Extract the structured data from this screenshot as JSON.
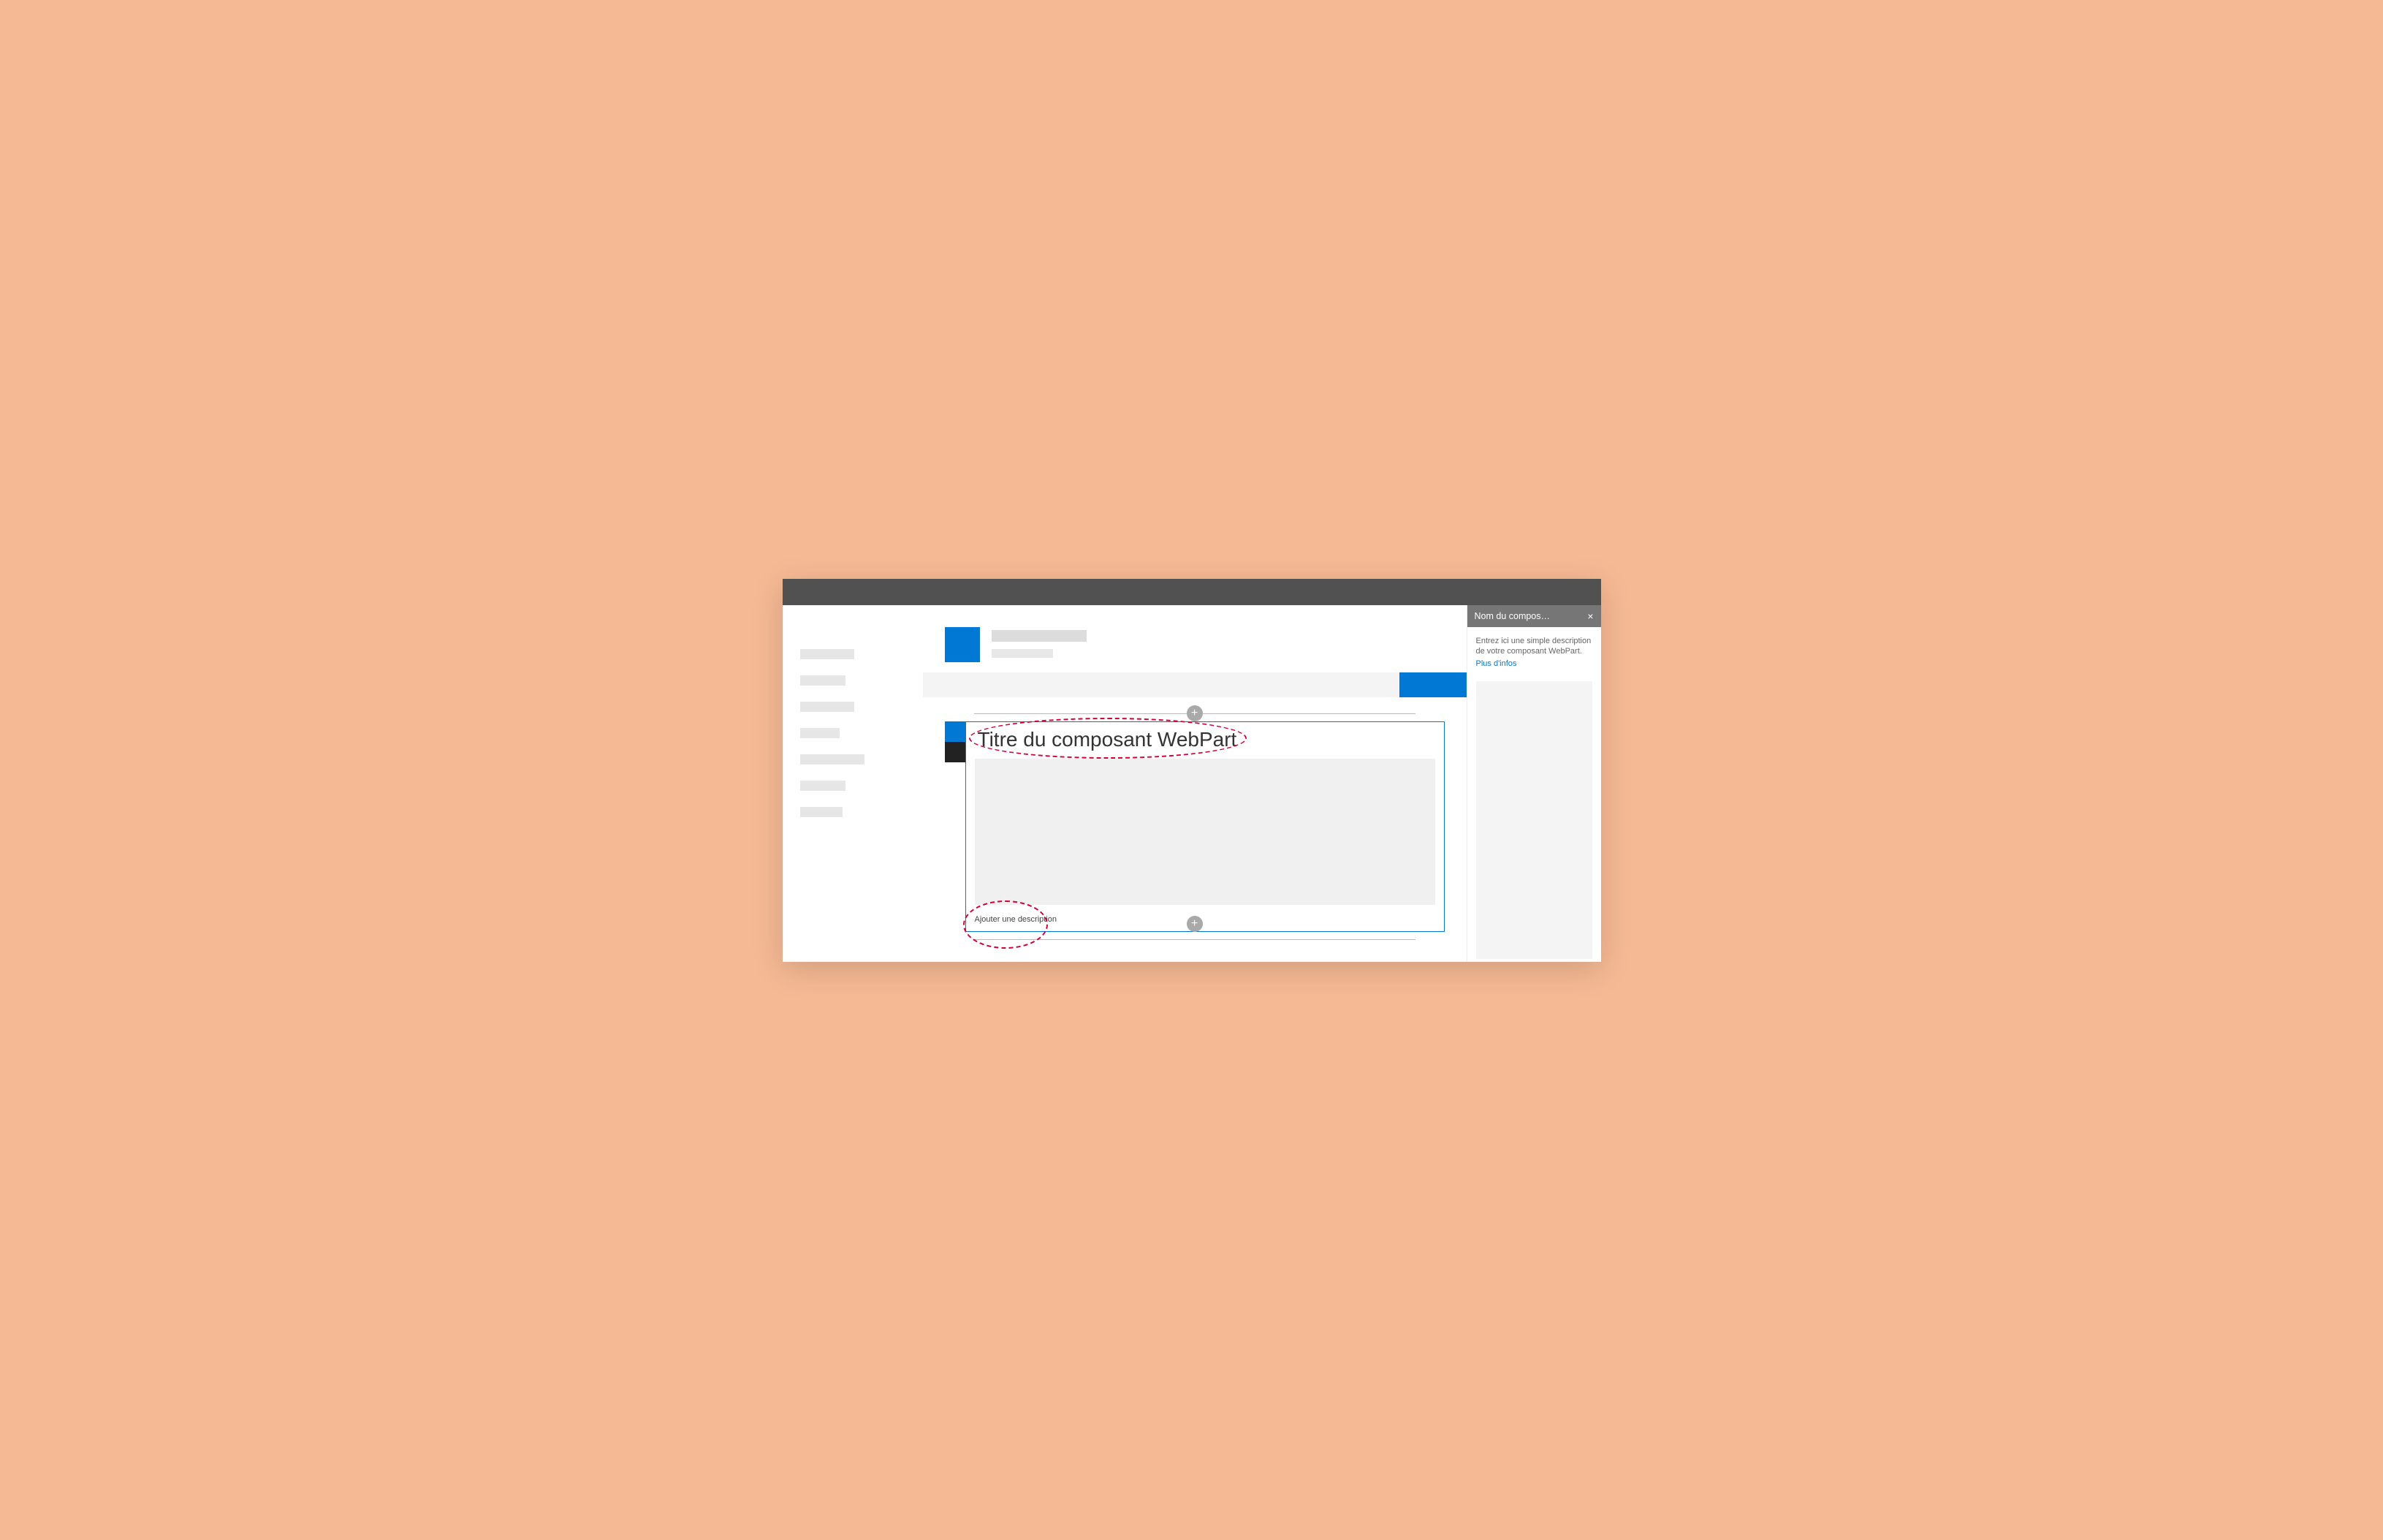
{
  "webpart": {
    "title": "Titre du composant WebPart",
    "description_placeholder": "Ajouter une description"
  },
  "panel": {
    "title": "Nom du compos…",
    "help_text": "Entrez ici une simple description de votre composant WebPart.",
    "more_link": "Plus d'infos"
  },
  "icons": {
    "add": "+",
    "close": "×"
  }
}
